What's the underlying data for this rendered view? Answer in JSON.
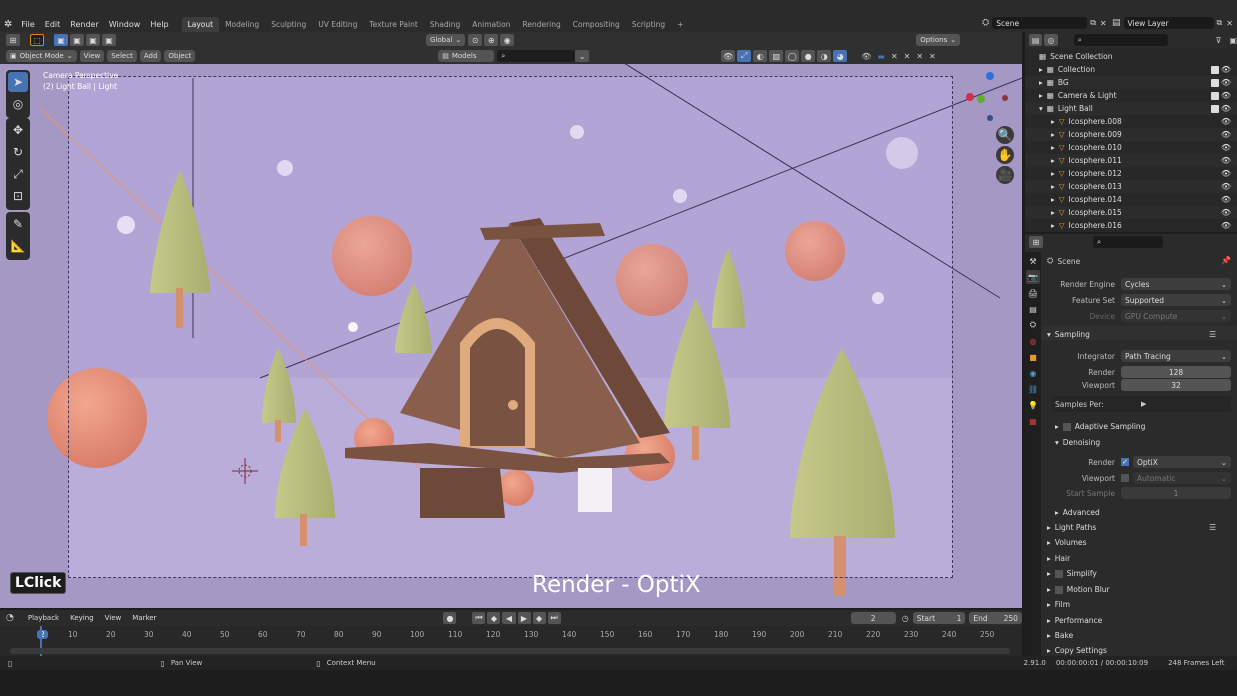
{
  "menu": [
    "File",
    "Edit",
    "Render",
    "Window",
    "Help"
  ],
  "workspaces": [
    {
      "label": "Layout",
      "active": true
    },
    {
      "label": "Modeling"
    },
    {
      "label": "Sculpting"
    },
    {
      "label": "UV Editing"
    },
    {
      "label": "Texture Paint"
    },
    {
      "label": "Shading"
    },
    {
      "label": "Animation"
    },
    {
      "label": "Rendering"
    },
    {
      "label": "Compositing"
    },
    {
      "label": "Scripting"
    }
  ],
  "add_workspace": "+",
  "scene_name": "Scene",
  "view_layer": "View Layer",
  "viewport": {
    "transform_orientation": "Global",
    "options_label": "Options",
    "mode": "Object Mode",
    "menus": [
      "View",
      "Select",
      "Add",
      "Object"
    ],
    "collection_dropdown": "Models",
    "camera_text": "Camera Perspective",
    "object_text": "(2) Light Ball | Light",
    "caption": "Render - OptiX",
    "lclick": "LClick"
  },
  "timeline": {
    "menus": [
      "Playback",
      "Keying",
      "View",
      "Marker"
    ],
    "current_frame": "2",
    "start_label": "Start",
    "start": "1",
    "end_label": "End",
    "end": "250",
    "ticks": [
      "2",
      "10",
      "20",
      "30",
      "40",
      "50",
      "60",
      "70",
      "80",
      "90",
      "100",
      "110",
      "120",
      "130",
      "140",
      "150",
      "160",
      "170",
      "180",
      "190",
      "200",
      "210",
      "220",
      "230",
      "240",
      "250"
    ]
  },
  "status": {
    "pan": "Pan View",
    "context": "Context Menu",
    "version": "2.91.0",
    "time": "00:00:00:01 / 00:00:10:09",
    "frames_left": "248 Frames Left"
  },
  "outliner": {
    "root": "Scene Collection",
    "items": [
      {
        "label": "Collection",
        "indent": 1
      },
      {
        "label": "BG",
        "indent": 1
      },
      {
        "label": "Camera & Light",
        "indent": 1
      },
      {
        "label": "Light Ball",
        "indent": 1,
        "expanded": true
      },
      {
        "label": "Icosphere.008",
        "indent": 2
      },
      {
        "label": "Icosphere.009",
        "indent": 2
      },
      {
        "label": "Icosphere.010",
        "indent": 2
      },
      {
        "label": "Icosphere.011",
        "indent": 2
      },
      {
        "label": "Icosphere.012",
        "indent": 2
      },
      {
        "label": "Icosphere.013",
        "indent": 2
      },
      {
        "label": "Icosphere.014",
        "indent": 2
      },
      {
        "label": "Icosphere.015",
        "indent": 2
      },
      {
        "label": "Icosphere.016",
        "indent": 2
      }
    ]
  },
  "properties": {
    "breadcrumb": "Scene",
    "render_engine_label": "Render Engine",
    "render_engine": "Cycles",
    "feature_set_label": "Feature Set",
    "feature_set": "Supported",
    "device_label": "Device",
    "device": "GPU Compute",
    "sampling": "Sampling",
    "integrator_label": "Integrator",
    "integrator": "Path Tracing",
    "render_label": "Render",
    "render_samples": "128",
    "viewport_label": "Viewport",
    "viewport_samples": "32",
    "samples_per": "Samples Per:",
    "adaptive": "Adaptive Sampling",
    "denoising": "Denoising",
    "denoise_render_label": "Render",
    "denoise_render": "OptiX",
    "denoise_viewport_label": "Viewport",
    "denoise_viewport": "Automatic",
    "start_sample_label": "Start Sample",
    "start_sample": "1",
    "advanced": "Advanced",
    "light_paths": "Light Paths",
    "volumes": "Volumes",
    "hair": "Hair",
    "simplify": "Simplify",
    "motion_blur": "Motion Blur",
    "film": "Film",
    "performance": "Performance",
    "bake": "Bake",
    "copy_settings": "Copy Settings"
  },
  "colors": {
    "accent": "#4772b3",
    "viewport_bg": "#a598c4",
    "panel": "#2b2b2b"
  }
}
